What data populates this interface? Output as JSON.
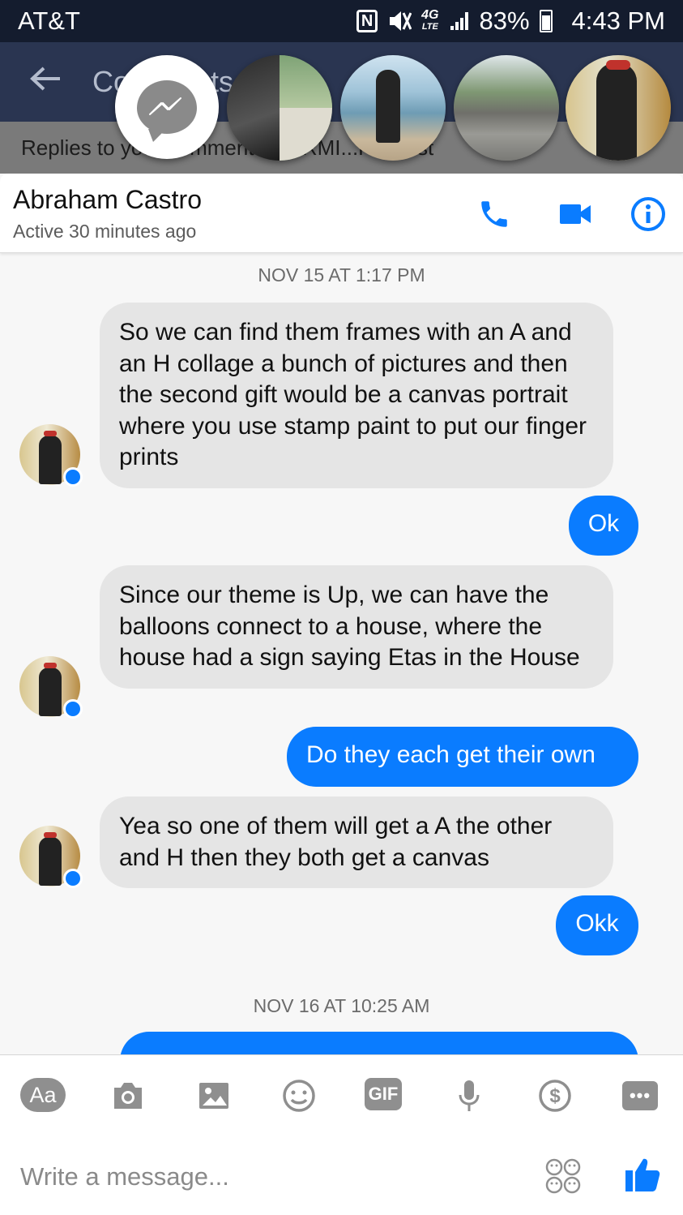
{
  "status_bar": {
    "carrier": "AT&T",
    "network": "4G",
    "network_sub": "LTE",
    "battery": "83%",
    "time": "4:43 PM"
  },
  "background_app": {
    "title": "Comments",
    "replies_text": "Replies to your comment on ARMI...R's post"
  },
  "conversation": {
    "contact_name": "Abraham Castro",
    "active_status": "Active 30 minutes ago"
  },
  "messages": {
    "ts1": "NOV 15 AT 1:17 PM",
    "m1": "So we can find them frames with an A and an H collage a bunch of pictures and then the second gift would be a canvas portrait where you use stamp paint to put our finger prints",
    "m2": "Ok",
    "m3": "Since our theme is Up, we can have the balloons connect to a house, where the house had a sign saying Etas in the House",
    "m4": "Do they each get their own",
    "m5": "Yea so one of them will get a A the other and H then they both get a canvas",
    "m6": "Okk",
    "ts2": "NOV 16 AT 10:25 AM"
  },
  "composer": {
    "aa_label": "Aa",
    "gif_label": "GIF",
    "more_label": "•••",
    "placeholder": "Write a message..."
  },
  "colors": {
    "accent": "#0a7cff",
    "incoming_bubble": "#e5e5e5",
    "status_bar": "#141c2e"
  },
  "icons": [
    "messenger-icon",
    "back-arrow-icon",
    "phone-icon",
    "video-camera-icon",
    "info-icon",
    "camera-icon",
    "image-icon",
    "emoji-icon",
    "microphone-icon",
    "payment-icon",
    "stickers-icon",
    "thumbs-up-icon"
  ]
}
